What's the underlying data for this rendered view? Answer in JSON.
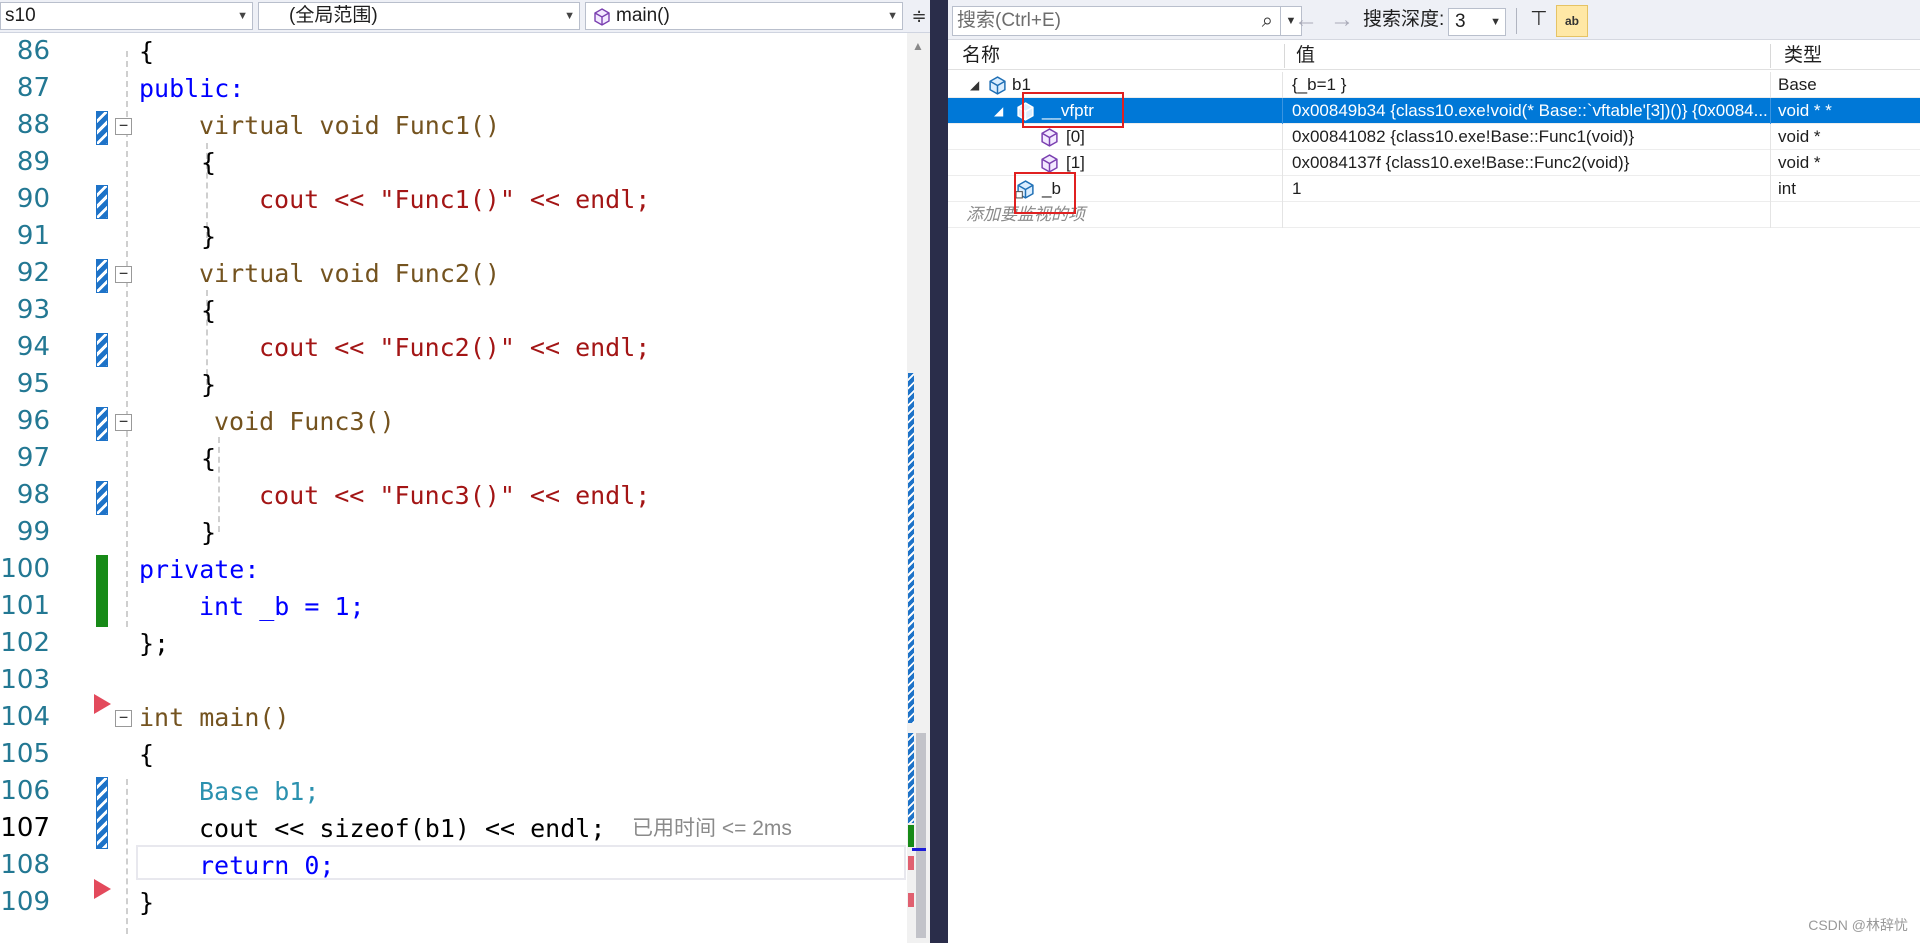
{
  "editor": {
    "nav": {
      "project": "s10",
      "scope": "(全局范围)",
      "member": "main()",
      "split_icon": "split-view-icon"
    },
    "lines": [
      {
        "num": "86",
        "text": "{"
      },
      {
        "num": "87",
        "text": "public:"
      },
      {
        "num": "88",
        "text": "virtual void Func1()"
      },
      {
        "num": "89",
        "text": "{"
      },
      {
        "num": "90",
        "text": "cout << \"Func1()\" << endl;"
      },
      {
        "num": "91",
        "text": "}"
      },
      {
        "num": "92",
        "text": "virtual void Func2()"
      },
      {
        "num": "93",
        "text": "{"
      },
      {
        "num": "94",
        "text": "cout << \"Func2()\" << endl;"
      },
      {
        "num": "95",
        "text": "}"
      },
      {
        "num": "96",
        "text": "void Func3()"
      },
      {
        "num": "97",
        "text": "{"
      },
      {
        "num": "98",
        "text": "cout << \"Func3()\" << endl;"
      },
      {
        "num": "99",
        "text": "}"
      },
      {
        "num": "100",
        "text": "private:"
      },
      {
        "num": "101",
        "text": "int _b = 1;"
      },
      {
        "num": "102",
        "text": "};"
      },
      {
        "num": "103",
        "text": ""
      },
      {
        "num": "104",
        "text": "int main()"
      },
      {
        "num": "105",
        "text": "{"
      },
      {
        "num": "106",
        "text": "Base b1;"
      },
      {
        "num": "107",
        "text": "cout << sizeof(b1) << endl;"
      },
      {
        "num": "108",
        "text": "return 0;"
      },
      {
        "num": "109",
        "text": "}"
      }
    ],
    "current_line": "107",
    "perf_tip": "已用时间 <= 2ms"
  },
  "watch": {
    "search_placeholder": "搜索(Ctrl+E)",
    "depth_label": "搜索深度:",
    "depth_value": "3",
    "hex_label": "ab",
    "columns": {
      "name": "名称",
      "value": "值",
      "type": "类型"
    },
    "rows": [
      {
        "name": "b1",
        "value": "{_b=1 }",
        "type": "Base",
        "expanded": true,
        "level": 0
      },
      {
        "name": "__vfptr",
        "value": "0x00849b34 {class10.exe!void(* Base::`vftable'[3])()} {0x0084...",
        "type": "void * *",
        "expanded": true,
        "level": 1,
        "selected": true
      },
      {
        "name": "[0]",
        "value": "0x00841082 {class10.exe!Base::Func1(void)}",
        "type": "void *",
        "level": 2
      },
      {
        "name": "[1]",
        "value": "0x0084137f {class10.exe!Base::Func2(void)}",
        "type": "void *",
        "level": 2
      },
      {
        "name": "_b",
        "value": "1",
        "type": "int",
        "level": 1
      }
    ],
    "add_item_placeholder": "添加要监视的项"
  },
  "watermark": "CSDN @林辞忧",
  "colors": {
    "keyword": "#0000ff",
    "function": "#74531f",
    "string": "#a31515",
    "operator": "#008080",
    "type": "#2b91af",
    "selection": "#0078d7",
    "highlight_box": "#e02020"
  }
}
